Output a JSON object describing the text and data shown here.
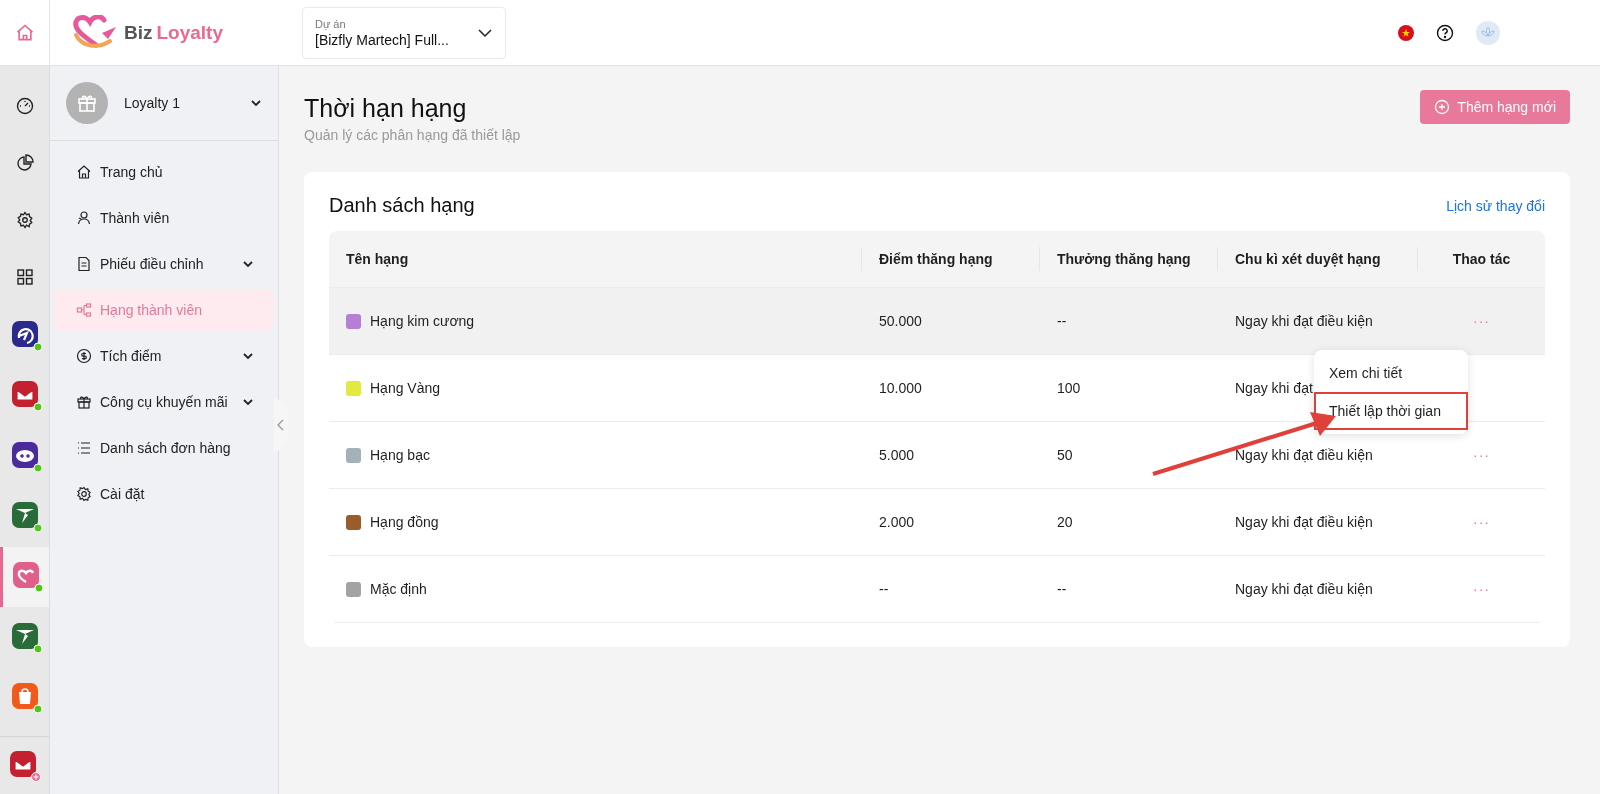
{
  "header": {
    "brand": {
      "first": "Biz",
      "second": "Loyalty"
    },
    "project": {
      "label": "Dự án",
      "value": "[Bizfly Martech] Full..."
    }
  },
  "rail": {
    "tools": [
      {
        "kind": "gauge"
      },
      {
        "kind": "pie"
      },
      {
        "kind": "gear"
      },
      {
        "kind": "grid"
      }
    ],
    "apps": [
      {
        "kind": "swirl",
        "color": "#2a2a8c",
        "selected": false,
        "online": true
      },
      {
        "kind": "mail",
        "color": "#c4202f",
        "selected": false,
        "online": true
      },
      {
        "kind": "bot",
        "color": "#4b2a9c",
        "selected": false,
        "online": true
      },
      {
        "kind": "plane",
        "color": "#2a6b3a",
        "selected": false,
        "online": true
      },
      {
        "kind": "heart",
        "color": "#e0608a",
        "selected": true,
        "online": true
      },
      {
        "kind": "plane",
        "color": "#2a6b3a",
        "selected": false,
        "online": true
      },
      {
        "kind": "bag",
        "color": "#f25a1c",
        "selected": false,
        "online": true
      }
    ],
    "bottom": {
      "kind": "mail",
      "color": "#c4202f"
    }
  },
  "sidebar": {
    "account": "Loyalty 1",
    "items": [
      {
        "label": "Trang chủ",
        "kind": "home",
        "expandable": false,
        "selected": false
      },
      {
        "label": "Thành viên",
        "kind": "user",
        "expandable": false,
        "selected": false
      },
      {
        "label": "Phiếu điều chỉnh",
        "kind": "doc",
        "expandable": true,
        "selected": false
      },
      {
        "label": "Hạng thành viên",
        "kind": "tree",
        "expandable": false,
        "selected": true
      },
      {
        "label": "Tích điểm",
        "kind": "coin",
        "expandable": true,
        "selected": false
      },
      {
        "label": "Công cụ khuyến mãi",
        "kind": "gift",
        "expandable": true,
        "selected": false
      },
      {
        "label": "Danh sách đơn hàng",
        "kind": "list",
        "expandable": false,
        "selected": false
      },
      {
        "label": "Cài đặt",
        "kind": "gear",
        "expandable": false,
        "selected": false
      }
    ]
  },
  "page": {
    "title": "Thời hạn hạng",
    "subtitle": "Quản lý các phân hạng đã thiết lập",
    "add_button": "Thêm hạng mới"
  },
  "card": {
    "title": "Danh sách hạng",
    "history_link": "Lịch sử thay đổi",
    "table": {
      "columns": [
        "Tên hạng",
        "Điểm thăng hạng",
        "Thưởng thăng hạng",
        "Chu kì xét duyệt hạng",
        "Thao tác"
      ],
      "rows": [
        {
          "name": "Hạng kim cương",
          "color": "#b57fd6",
          "points": "50.000",
          "reward": "--",
          "cycle": "Ngay khi đạt điều kiện",
          "actions": "···",
          "hovered": true
        },
        {
          "name": "Hạng Vàng",
          "color": "#e3ea3d",
          "points": "10.000",
          "reward": "100",
          "cycle": "Ngay khi đạt",
          "hovered": false
        },
        {
          "name": "Hạng bạc",
          "color": "#a4b1b8",
          "points": "5.000",
          "reward": "50",
          "cycle": "Ngay khi đạt điều kiện",
          "actions": "···",
          "hovered": false
        },
        {
          "name": "Hạng đồng",
          "color": "#9a5c2a",
          "points": "2.000",
          "reward": "20",
          "cycle": "Ngay khi đạt điều kiện",
          "actions": "···",
          "hovered": false
        },
        {
          "name": "Mặc định",
          "color": "#a3a3a3",
          "points": "--",
          "reward": "--",
          "cycle": "Ngay khi đạt điều kiện",
          "actions": "···",
          "hovered": false
        }
      ]
    }
  },
  "action_menu": {
    "items": [
      {
        "label": "Xem chi tiết",
        "outlined": false
      },
      {
        "label": "Thiết lập thời gian",
        "outlined": true
      }
    ]
  }
}
